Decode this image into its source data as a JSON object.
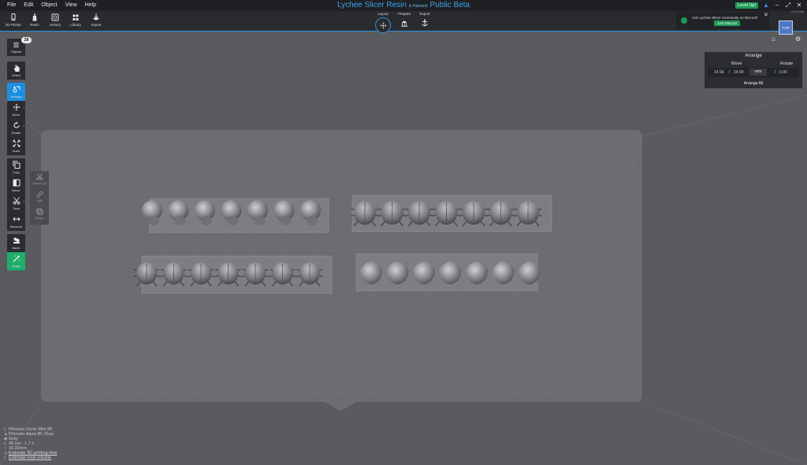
{
  "menu": [
    "File",
    "Edit",
    "Object",
    "View",
    "Help"
  ],
  "title": {
    "main": "Lychee Slicer Resin",
    "mid": "& Filament",
    "tail": "Public Beta"
  },
  "window": {
    "level_up": "Level Up!"
  },
  "version": "6.0.0 beta",
  "toolbar": {
    "left": [
      {
        "label": "3D Printer",
        "icon": "printer-icon"
      },
      {
        "label": "Resin",
        "icon": "resin-bottle-icon"
      },
      {
        "label": "History",
        "icon": "history-icon"
      },
      {
        "label": "Library",
        "icon": "library-icon"
      },
      {
        "label": "Import",
        "icon": "import-icon"
      }
    ],
    "stages": [
      {
        "label": "Layout",
        "icon": "layout-move-icon",
        "active": true
      },
      {
        "label": "Prepare",
        "icon": "prepare-supports-icon",
        "active": false
      },
      {
        "label": "Export",
        "icon": "export-anchor-icon",
        "active": false
      }
    ]
  },
  "discord": {
    "text": "Join Lychee Slicer community on Discord!",
    "button": "Join Discord"
  },
  "view_cube": {
    "label": "TOP"
  },
  "objects": {
    "label": "Objects",
    "count": "28"
  },
  "tools": [
    {
      "label": "Select",
      "icon": "select-hand-icon",
      "active": false,
      "more": false
    },
    {
      "label": "Arrange",
      "icon": "arrange-icon",
      "active": true,
      "more": false
    },
    {
      "label": "Move",
      "icon": "move-icon",
      "active": false,
      "more": true
    },
    {
      "label": "Rotate",
      "icon": "rotate-icon",
      "active": false,
      "more": true
    },
    {
      "label": "Scale",
      "icon": "scale-icon",
      "active": false,
      "more": false
    },
    {
      "label": "Copy",
      "icon": "copy-icon",
      "active": false,
      "more": false
    },
    {
      "label": "Mirror",
      "icon": "mirror-icon",
      "active": false,
      "more": false
    },
    {
      "label": "Tools",
      "icon": "scissors-icon",
      "active": false,
      "more": true
    },
    {
      "label": "Measure",
      "icon": "measure-icon",
      "active": false,
      "more": false
    },
    {
      "label": "Batch",
      "icon": "batch-icon",
      "active": false,
      "more": false
    },
    {
      "label": "Magic",
      "icon": "magic-wand-icon",
      "active": false,
      "more": false
    }
  ],
  "subtools": [
    {
      "label": "Planar Cut",
      "icon": "planar-cut-icon"
    },
    {
      "label": "Split",
      "icon": "split-icon"
    },
    {
      "label": "Merge",
      "icon": "merge-icon"
    }
  ],
  "arrange": {
    "title": "Arrange",
    "move_label": "Move",
    "rotate_label": "Rotate",
    "x_value": "14.94",
    "y_axis": "Y",
    "y_value": "14.90",
    "unit": "mm",
    "z_axis": "Z",
    "rotate_value": "0.00",
    "arrange_all": "Arrange All"
  },
  "info": [
    {
      "icon": "printer-icon",
      "text": "Phrozen Sonic Mini 8K",
      "link": false
    },
    {
      "icon": "resin-icon",
      "text": "Phrozen Aqua 8K (Tea)",
      "link": false
    },
    {
      "icon": "color-icon",
      "text": "Grey",
      "link": false
    },
    {
      "icon": "layer-icon",
      "text": "40 um - 1.7 s",
      "link": false
    },
    {
      "icon": "height-icon",
      "text": "16.32mm",
      "link": false
    },
    {
      "icon": "clock-icon",
      "text": "Estimate 3D printing time",
      "link": true
    },
    {
      "icon": "volume-icon",
      "text": "Estimate resin volume",
      "link": true
    }
  ],
  "colors": {
    "accent": "#2f8fd6",
    "green": "#1e9a58",
    "plate": "#6b6d71",
    "background": "#595b5f"
  }
}
